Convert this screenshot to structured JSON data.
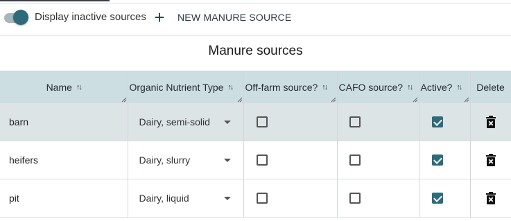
{
  "toolbar": {
    "inactive_toggle_label": "Display inactive sources",
    "inactive_toggle_on": true,
    "new_source_label": "NEW MANURE SOURCE"
  },
  "page_title": "Manure sources",
  "table": {
    "columns": [
      {
        "label": "Name",
        "sortable": true
      },
      {
        "label": "Organic Nutrient Type",
        "sortable": true
      },
      {
        "label": "Off-farm source?",
        "sortable": true
      },
      {
        "label": "CAFO source?",
        "sortable": true
      },
      {
        "label": "Active?",
        "sortable": true
      },
      {
        "label": "Delete",
        "sortable": false
      }
    ],
    "rows": [
      {
        "name": "barn",
        "type": "Dairy, semi-solid",
        "off_farm": false,
        "cafo": false,
        "active": true,
        "selected": true
      },
      {
        "name": "heifers",
        "type": "Dairy, slurry",
        "off_farm": false,
        "cafo": false,
        "active": true,
        "selected": false
      },
      {
        "name": "pit",
        "type": "Dairy, liquid",
        "off_farm": false,
        "cafo": false,
        "active": true,
        "selected": false
      }
    ]
  },
  "colors": {
    "accent": "#2d6b7a",
    "header_bg": "#cddee3",
    "selected_row_bg": "#dde4e6"
  },
  "icons": {
    "sort": "sort-arrows-icon",
    "add": "plus-icon",
    "delete": "trash-icon",
    "dropdown": "caret-down-icon"
  }
}
